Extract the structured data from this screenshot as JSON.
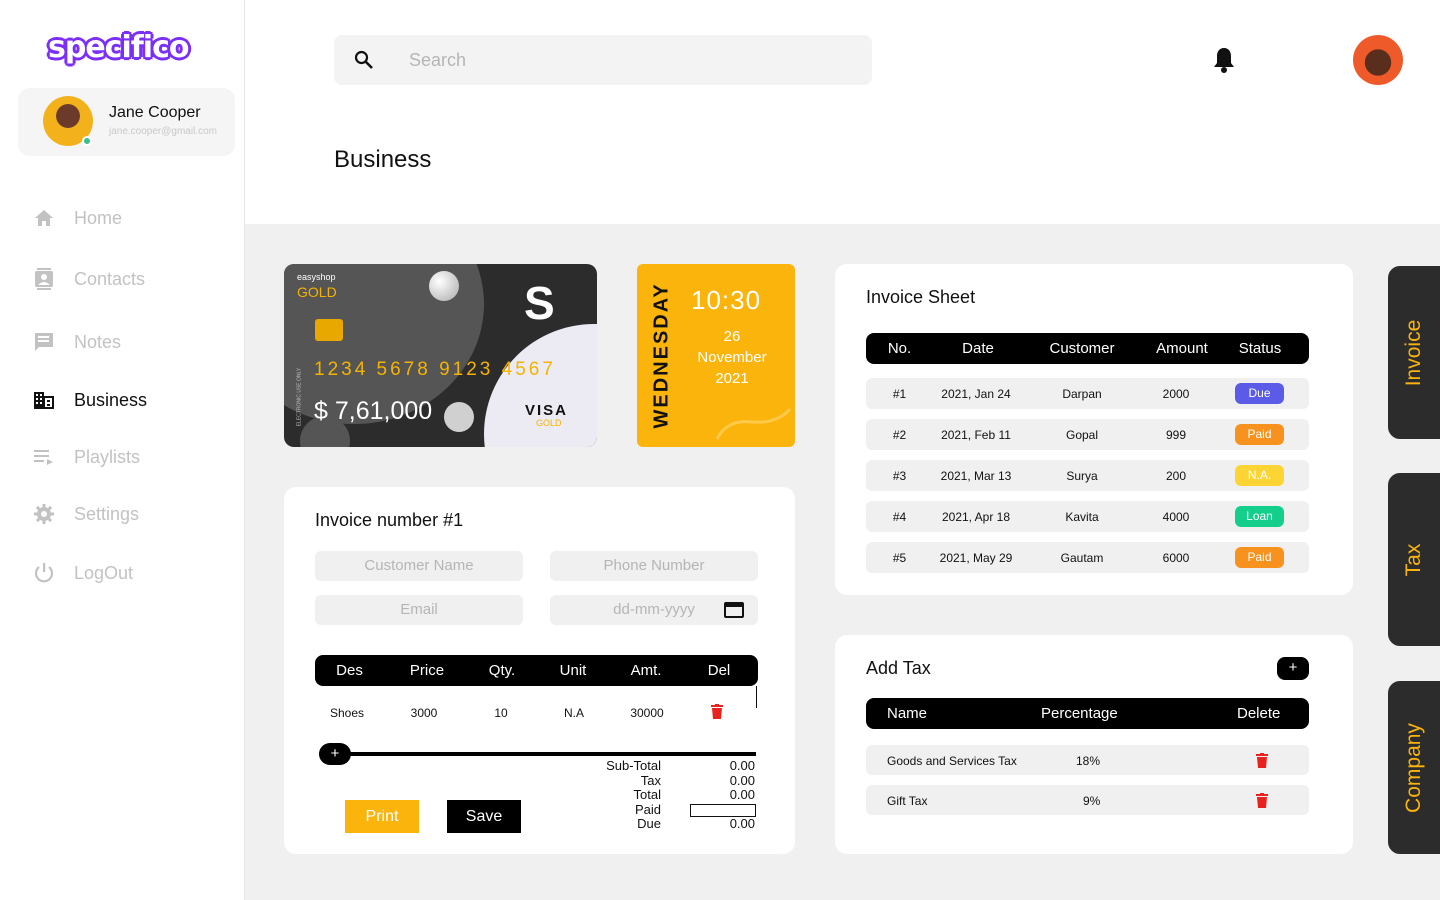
{
  "brand": {
    "logo": "specifico"
  },
  "profile": {
    "name": "Jane Cooper",
    "email": "jane.cooper@gmail.com"
  },
  "nav": [
    {
      "label": "Home",
      "icon": "home-icon",
      "active": false
    },
    {
      "label": "Contacts",
      "icon": "contacts-icon",
      "active": false
    },
    {
      "label": "Notes",
      "icon": "notes-icon",
      "active": false
    },
    {
      "label": "Business",
      "icon": "business-icon",
      "active": true
    },
    {
      "label": "Playlists",
      "icon": "playlist-icon",
      "active": false
    },
    {
      "label": "Settings",
      "icon": "gear-icon",
      "active": false
    },
    {
      "label": "LogOut",
      "icon": "power-icon",
      "active": false
    }
  ],
  "search": {
    "placeholder": "Search"
  },
  "page": {
    "title": "Business"
  },
  "card": {
    "brand": "easyshop",
    "tier": "GOLD",
    "number": "1234 5678 9123 4567",
    "balance": "$ 7,61,000",
    "network": "VISA",
    "network_tier": "GOLD",
    "side_text": "ELECTRONIC USE ONLY",
    "logo": "S"
  },
  "datecard": {
    "day": "WEDNESDAY",
    "time": "10:30",
    "date_day": "26",
    "date_month": "November",
    "date_year": "2021"
  },
  "invoice_form": {
    "title": "Invoice number #1",
    "customer_placeholder": "Customer Name",
    "phone_placeholder": "Phone Number",
    "email_placeholder": "Email",
    "date_placeholder": "dd-mm-yyyy",
    "columns": [
      "Des",
      "Price",
      "Qty.",
      "Unit",
      "Amt.",
      "Del"
    ],
    "rows": [
      {
        "des": "Shoes",
        "price": "3000",
        "qty": "10",
        "unit": "N.A",
        "amt": "30000"
      }
    ],
    "add_label": "+",
    "totals": [
      {
        "label": "Sub-Total",
        "value": "0.00"
      },
      {
        "label": "Tax",
        "value": "0.00"
      },
      {
        "label": "Total",
        "value": "0.00"
      },
      {
        "label": "Paid",
        "value": ""
      },
      {
        "label": "Due",
        "value": "0.00"
      }
    ],
    "print_label": "Print",
    "save_label": "Save"
  },
  "invoice_sheet": {
    "title": "Invoice Sheet",
    "columns": [
      "No.",
      "Date",
      "Customer",
      "Amount",
      "Status"
    ],
    "rows": [
      {
        "no": "#1",
        "date": "2021, Jan 24",
        "customer": "Darpan",
        "amount": "2000",
        "status": "Due",
        "color": "#5b5be8"
      },
      {
        "no": "#2",
        "date": "2021, Feb 11",
        "customer": "Gopal",
        "amount": "999",
        "status": "Paid",
        "color": "#f7921e"
      },
      {
        "no": "#3",
        "date": "2021, Mar 13",
        "customer": "Surya",
        "amount": "200",
        "status": "N.A.",
        "color": "#fcd535"
      },
      {
        "no": "#4",
        "date": "2021, Apr 18",
        "customer": "Kavita",
        "amount": "4000",
        "status": "Loan",
        "color": "#14cf8c"
      },
      {
        "no": "#5",
        "date": "2021, May 29",
        "customer": "Gautam",
        "amount": "6000",
        "status": "Paid",
        "color": "#f7921e"
      }
    ]
  },
  "tax": {
    "title": "Add Tax",
    "add_label": "+",
    "columns": [
      "Name",
      "Percentage",
      "Delete"
    ],
    "rows": [
      {
        "name": "Goods and Services Tax",
        "percentage": "18%"
      },
      {
        "name": "Gift Tax",
        "percentage": "9%"
      }
    ]
  },
  "side_tabs": [
    "Invoice",
    "Tax",
    "Company"
  ],
  "colors": {
    "accent": "#fbb40c",
    "brand": "#7b2ff7",
    "delete": "#e8231f",
    "dark": "#2c2c2c"
  }
}
